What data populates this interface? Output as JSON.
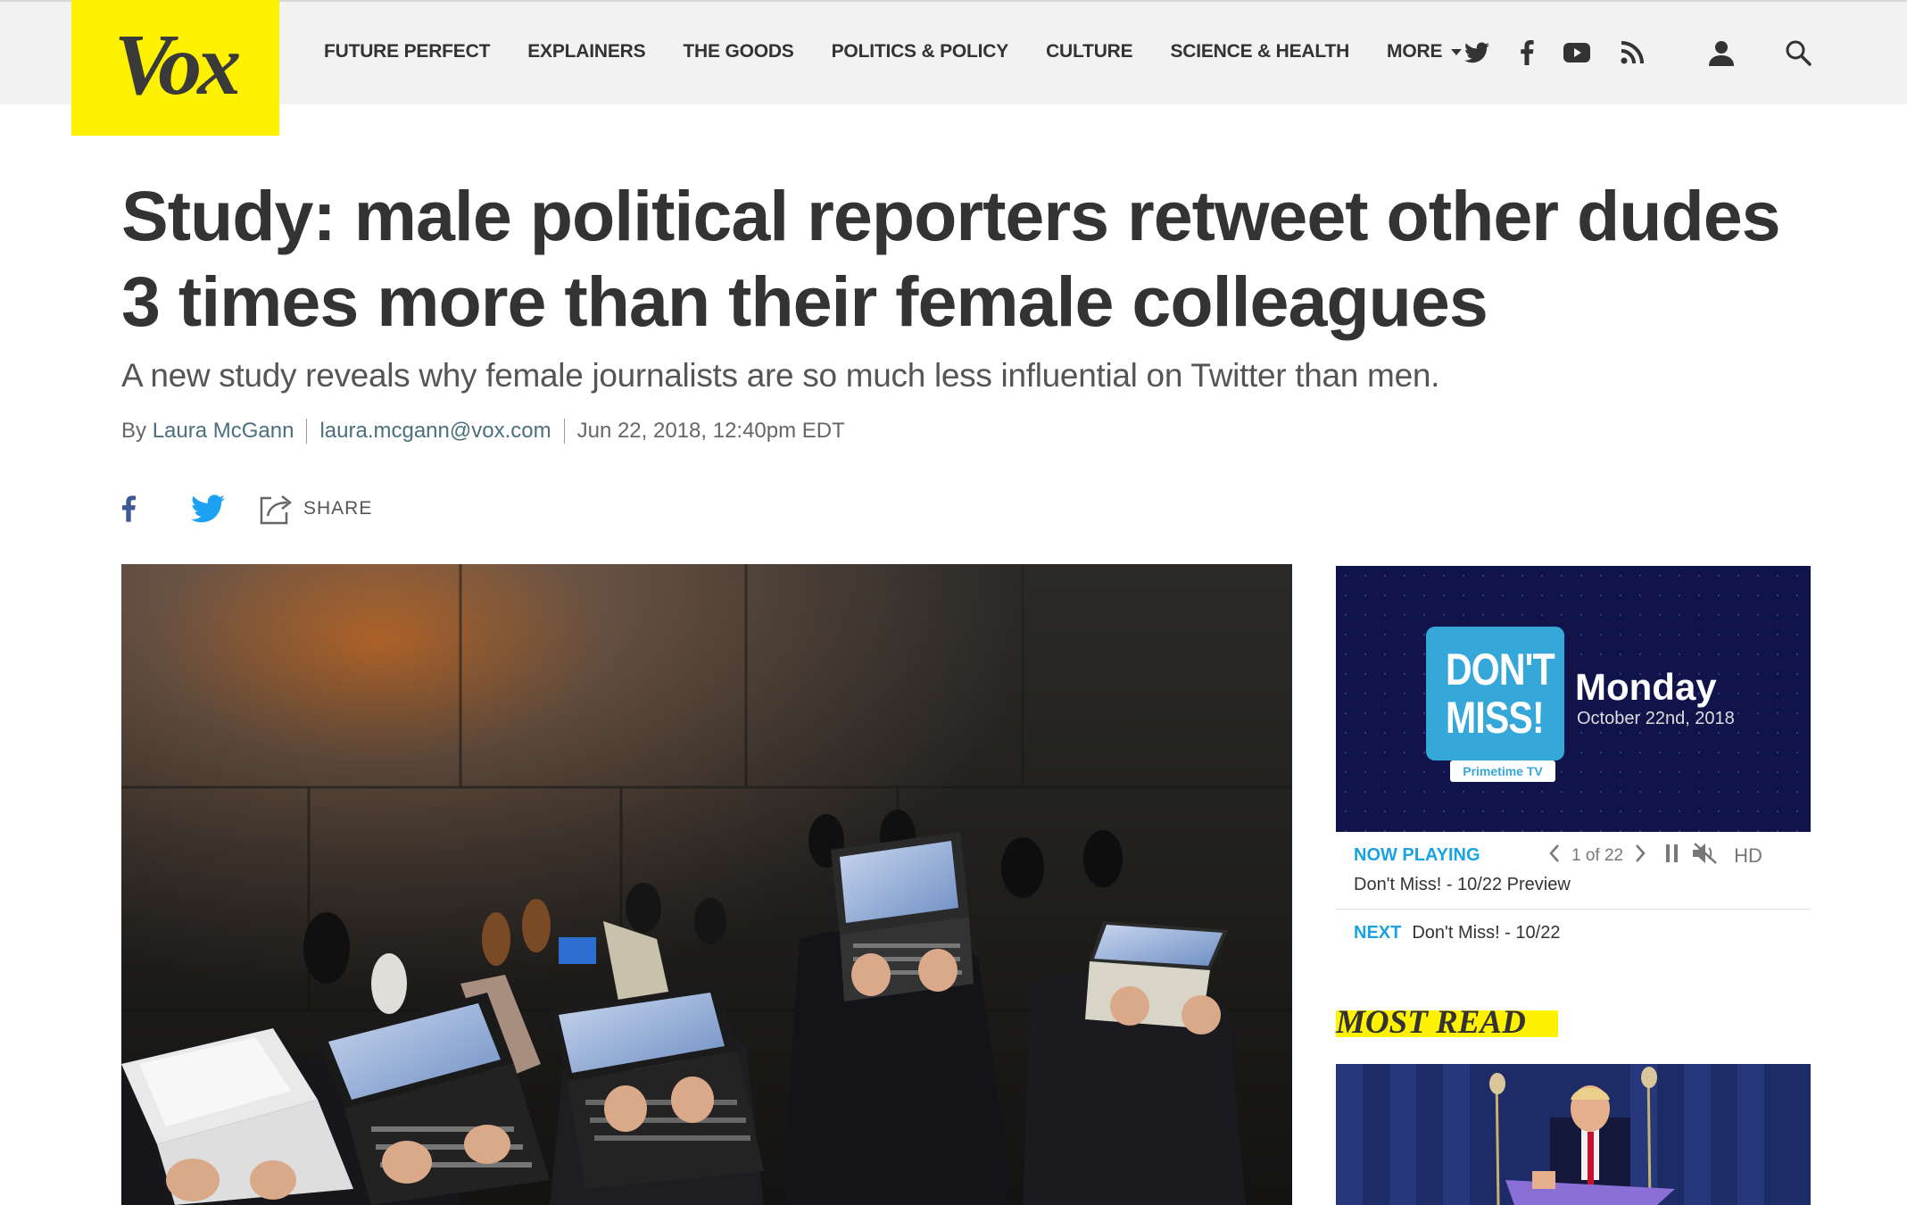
{
  "header": {
    "logo_text": "Vox",
    "nav": [
      {
        "label": "FUTURE PERFECT"
      },
      {
        "label": "EXPLAINERS"
      },
      {
        "label": "THE GOODS"
      },
      {
        "label": "POLITICS & POLICY"
      },
      {
        "label": "CULTURE"
      },
      {
        "label": "SCIENCE & HEALTH"
      }
    ],
    "more_label": "MORE",
    "social_icons": [
      "twitter-icon",
      "facebook-icon",
      "youtube-icon",
      "rss-icon"
    ],
    "account_icon": "user-icon",
    "search_icon": "search-icon"
  },
  "article": {
    "headline": "Study: male political reporters retweet other dudes 3 times more than their female colleagues",
    "dek": "A new study reveals why female journalists are so much less influential on Twitter than men.",
    "byline_prefix": "By",
    "author": "Laura McGann",
    "email": "laura.mcgann@vox.com",
    "date": "Jun 22, 2018, 12:40pm EDT",
    "share_label": "SHARE"
  },
  "video": {
    "promo_line1": "DON'T",
    "promo_line2": "MISS!",
    "promo_tag": "Primetime TV",
    "promo_day": "Monday",
    "promo_date": "October 22nd, 2018",
    "now_playing_label": "NOW PLAYING",
    "position": "1 of 22",
    "quality": "HD",
    "now_playing_title": "Don't Miss! - 10/22 Preview",
    "next_label": "NEXT",
    "next_title": "Don't Miss! - 10/22"
  },
  "rail": {
    "most_read_label": "MOST READ"
  },
  "colors": {
    "brand_yellow": "#fff200",
    "link_blue": "#1aa3e0",
    "facebook_blue": "#3b5998",
    "twitter_blue": "#1da1f2",
    "text_dark": "#333333"
  }
}
